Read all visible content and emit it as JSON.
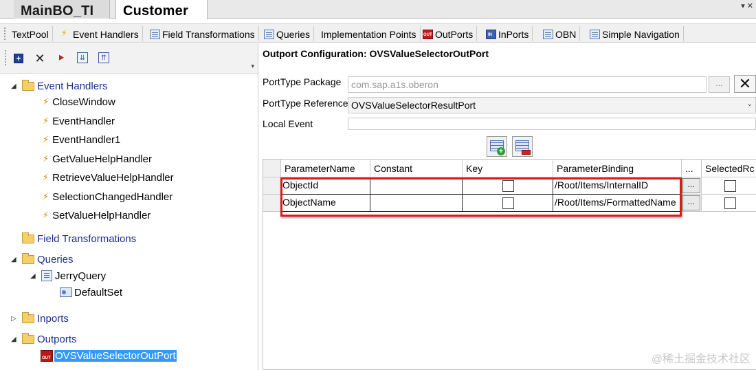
{
  "doc_tabs": [
    {
      "label": "MainBO_TI",
      "active": false
    },
    {
      "label": "Customer",
      "active": true
    }
  ],
  "doc_tab_menu": "▾ ✕",
  "sub_tabs": [
    {
      "label": "TextPool",
      "icon": "none"
    },
    {
      "label": "Event Handlers",
      "icon": "lightning-icon"
    },
    {
      "label": "Field Transformations",
      "icon": "grid-icon"
    },
    {
      "label": "Queries",
      "icon": "grid-icon"
    },
    {
      "label": "Implementation Points",
      "icon": "none"
    },
    {
      "label": "OutPorts",
      "icon": "outport-icon"
    },
    {
      "label": "InPorts",
      "icon": "inport-icon"
    },
    {
      "label": "OBN",
      "icon": "grid-icon"
    },
    {
      "label": "Simple Navigation",
      "icon": "grid-icon"
    }
  ],
  "left_toolbar": {
    "add": "+",
    "delete": "✕",
    "tool": "⯈",
    "expand_all": "⇊",
    "collapse_all": "⇈",
    "overflow": "▾"
  },
  "tree": {
    "event_handlers": {
      "label": "Event Handlers",
      "children": [
        "CloseWindow",
        "EventHandler",
        "EventHandler1",
        "GetValueHelpHandler",
        "RetrieveValueHelpHandler",
        "SelectionChangedHandler",
        "SetValueHelpHandler"
      ]
    },
    "field_transformations": {
      "label": "Field Transformations"
    },
    "queries": {
      "label": "Queries",
      "query": "JerryQuery",
      "dataset": "DefaultSet"
    },
    "inports": {
      "label": "Inports"
    },
    "outports": {
      "label": "Outports",
      "selected": "OVSValueSelectorOutPort"
    },
    "bolt_glyph": "⚡",
    "expanded_glyph": "◢",
    "collapsed_glyph": "▷"
  },
  "outport_config": {
    "title": "Outport Configuration: OVSValueSelectorOutPort",
    "porttype_package_label": "PortType Package",
    "porttype_package_value": "com.sap.a1s.oberon",
    "browse_label": "...",
    "clear_label": "✕",
    "porttype_reference_label": "PortType Reference",
    "porttype_reference_value": "OVSValueSelectorResultPort",
    "local_event_label": "Local Event",
    "local_event_value": "",
    "select_arrow": "⌄"
  },
  "param_table": {
    "columns": [
      "ParameterName",
      "Constant",
      "Key",
      "ParameterBinding",
      "...",
      "SelectedRc"
    ],
    "rows": [
      {
        "name": "ObjectId",
        "constant": "",
        "key": false,
        "binding": "/Root/Items/InternalID",
        "dots": "...",
        "selected": false
      },
      {
        "name": "ObjectName",
        "constant": "",
        "key": false,
        "binding": "/Root/Items/FormattedName",
        "dots": "...",
        "selected": false
      }
    ]
  },
  "watermark": "@稀土掘金技术社区",
  "colors": {
    "highlight_outline": "#e01818",
    "selection": "#3399ff",
    "tree_text": "#1b2f8f"
  }
}
